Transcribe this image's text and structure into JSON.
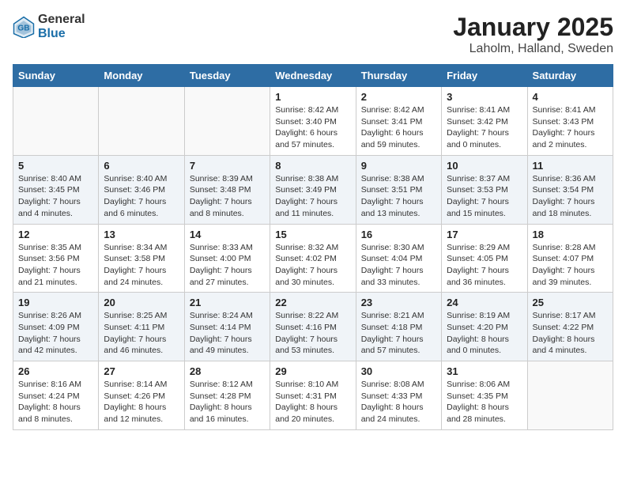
{
  "header": {
    "logo_general": "General",
    "logo_blue": "Blue",
    "title": "January 2025",
    "subtitle": "Laholm, Halland, Sweden"
  },
  "weekdays": [
    "Sunday",
    "Monday",
    "Tuesday",
    "Wednesday",
    "Thursday",
    "Friday",
    "Saturday"
  ],
  "weeks": [
    [
      {
        "day": "",
        "info": ""
      },
      {
        "day": "",
        "info": ""
      },
      {
        "day": "",
        "info": ""
      },
      {
        "day": "1",
        "info": "Sunrise: 8:42 AM\nSunset: 3:40 PM\nDaylight: 6 hours and 57 minutes."
      },
      {
        "day": "2",
        "info": "Sunrise: 8:42 AM\nSunset: 3:41 PM\nDaylight: 6 hours and 59 minutes."
      },
      {
        "day": "3",
        "info": "Sunrise: 8:41 AM\nSunset: 3:42 PM\nDaylight: 7 hours and 0 minutes."
      },
      {
        "day": "4",
        "info": "Sunrise: 8:41 AM\nSunset: 3:43 PM\nDaylight: 7 hours and 2 minutes."
      }
    ],
    [
      {
        "day": "5",
        "info": "Sunrise: 8:40 AM\nSunset: 3:45 PM\nDaylight: 7 hours and 4 minutes."
      },
      {
        "day": "6",
        "info": "Sunrise: 8:40 AM\nSunset: 3:46 PM\nDaylight: 7 hours and 6 minutes."
      },
      {
        "day": "7",
        "info": "Sunrise: 8:39 AM\nSunset: 3:48 PM\nDaylight: 7 hours and 8 minutes."
      },
      {
        "day": "8",
        "info": "Sunrise: 8:38 AM\nSunset: 3:49 PM\nDaylight: 7 hours and 11 minutes."
      },
      {
        "day": "9",
        "info": "Sunrise: 8:38 AM\nSunset: 3:51 PM\nDaylight: 7 hours and 13 minutes."
      },
      {
        "day": "10",
        "info": "Sunrise: 8:37 AM\nSunset: 3:53 PM\nDaylight: 7 hours and 15 minutes."
      },
      {
        "day": "11",
        "info": "Sunrise: 8:36 AM\nSunset: 3:54 PM\nDaylight: 7 hours and 18 minutes."
      }
    ],
    [
      {
        "day": "12",
        "info": "Sunrise: 8:35 AM\nSunset: 3:56 PM\nDaylight: 7 hours and 21 minutes."
      },
      {
        "day": "13",
        "info": "Sunrise: 8:34 AM\nSunset: 3:58 PM\nDaylight: 7 hours and 24 minutes."
      },
      {
        "day": "14",
        "info": "Sunrise: 8:33 AM\nSunset: 4:00 PM\nDaylight: 7 hours and 27 minutes."
      },
      {
        "day": "15",
        "info": "Sunrise: 8:32 AM\nSunset: 4:02 PM\nDaylight: 7 hours and 30 minutes."
      },
      {
        "day": "16",
        "info": "Sunrise: 8:30 AM\nSunset: 4:04 PM\nDaylight: 7 hours and 33 minutes."
      },
      {
        "day": "17",
        "info": "Sunrise: 8:29 AM\nSunset: 4:05 PM\nDaylight: 7 hours and 36 minutes."
      },
      {
        "day": "18",
        "info": "Sunrise: 8:28 AM\nSunset: 4:07 PM\nDaylight: 7 hours and 39 minutes."
      }
    ],
    [
      {
        "day": "19",
        "info": "Sunrise: 8:26 AM\nSunset: 4:09 PM\nDaylight: 7 hours and 42 minutes."
      },
      {
        "day": "20",
        "info": "Sunrise: 8:25 AM\nSunset: 4:11 PM\nDaylight: 7 hours and 46 minutes."
      },
      {
        "day": "21",
        "info": "Sunrise: 8:24 AM\nSunset: 4:14 PM\nDaylight: 7 hours and 49 minutes."
      },
      {
        "day": "22",
        "info": "Sunrise: 8:22 AM\nSunset: 4:16 PM\nDaylight: 7 hours and 53 minutes."
      },
      {
        "day": "23",
        "info": "Sunrise: 8:21 AM\nSunset: 4:18 PM\nDaylight: 7 hours and 57 minutes."
      },
      {
        "day": "24",
        "info": "Sunrise: 8:19 AM\nSunset: 4:20 PM\nDaylight: 8 hours and 0 minutes."
      },
      {
        "day": "25",
        "info": "Sunrise: 8:17 AM\nSunset: 4:22 PM\nDaylight: 8 hours and 4 minutes."
      }
    ],
    [
      {
        "day": "26",
        "info": "Sunrise: 8:16 AM\nSunset: 4:24 PM\nDaylight: 8 hours and 8 minutes."
      },
      {
        "day": "27",
        "info": "Sunrise: 8:14 AM\nSunset: 4:26 PM\nDaylight: 8 hours and 12 minutes."
      },
      {
        "day": "28",
        "info": "Sunrise: 8:12 AM\nSunset: 4:28 PM\nDaylight: 8 hours and 16 minutes."
      },
      {
        "day": "29",
        "info": "Sunrise: 8:10 AM\nSunset: 4:31 PM\nDaylight: 8 hours and 20 minutes."
      },
      {
        "day": "30",
        "info": "Sunrise: 8:08 AM\nSunset: 4:33 PM\nDaylight: 8 hours and 24 minutes."
      },
      {
        "day": "31",
        "info": "Sunrise: 8:06 AM\nSunset: 4:35 PM\nDaylight: 8 hours and 28 minutes."
      },
      {
        "day": "",
        "info": ""
      }
    ]
  ]
}
